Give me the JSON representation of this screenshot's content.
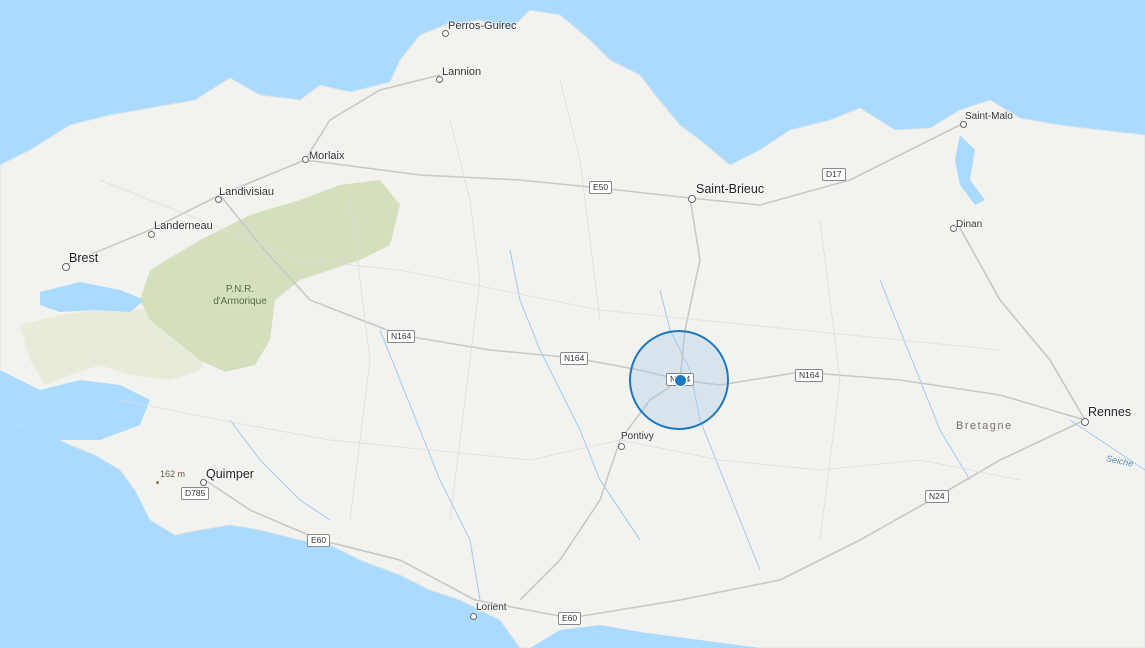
{
  "map": {
    "cities": {
      "perros_guirec": "Perros-Guirec",
      "lannion": "Lannion",
      "morlaix": "Morlaix",
      "landivisiau": "Landivisiau",
      "landerneau": "Landerneau",
      "brest": "Brest",
      "saint_brieuc": "Saint-Brieuc",
      "saint_malo": "Saint-Malo",
      "dinan": "Dinan",
      "pontivy": "Pontivy",
      "rennes": "Rennes",
      "quimper": "Quimper",
      "lorient": "Lorient"
    },
    "park_label": "P.N.R.\nd'Armorique",
    "region_label": "Bretagne",
    "river_label": "Seiche",
    "peak_label": "162 m",
    "roads": {
      "e50": "E50",
      "d17": "D17",
      "n164_west": "N164",
      "n164_center": "N164",
      "n164_east": "N164",
      "n164_pin": "N164",
      "d785": "D785",
      "e60_west": "E60",
      "e60_south": "E60",
      "n24": "N24"
    },
    "colors": {
      "sea": "#aadaff",
      "land": "#f2f2ef",
      "park_green": "#cfdcb4",
      "radius_stroke": "#1c78c0",
      "pin": "#1c78c0"
    }
  }
}
